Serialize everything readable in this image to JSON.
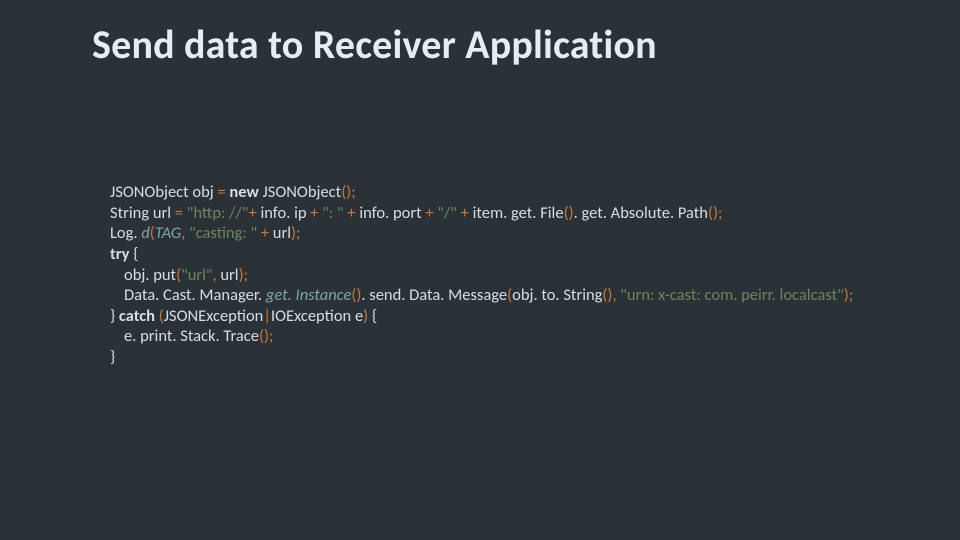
{
  "slide": {
    "title": "Send data to Receiver Application"
  },
  "code": {
    "l1": {
      "a": "JSONObject obj ",
      "eq": "= ",
      "new": "new ",
      "b": "JSONObject",
      "c": "()",
      "sc": ";"
    },
    "l2": {
      "a": "String url ",
      "eq": "= ",
      "s1": "\"http: //\"",
      "p1": "+ ",
      "b": "info. ip ",
      "p2": "+ ",
      "s2": "\": \" ",
      "p3": "+ ",
      "c": "info. port ",
      "p4": "+ ",
      "s3": "\"/\" ",
      "p5": "+ ",
      "d": "item. get. File",
      "pa1": "()",
      "dot": ". ",
      "e": "get. Absolute. Path",
      "pa2": "()",
      "sc": ";"
    },
    "l3": {
      "a": "Log. ",
      "m": "d",
      "po": "(",
      "tag": "TAG",
      "cm": ", ",
      "s": "\"casting: \" ",
      "pl": "+ ",
      "b": "url",
      "pc": ")",
      "sc": ";"
    },
    "l4": {
      "try": "try ",
      "br": "{"
    },
    "l5": {
      "a": "obj. put",
      "po": "(",
      "s": "\"url\"",
      "cm": ", ",
      "b": "url",
      "pc": ")",
      "sc": ";"
    },
    "l6": {
      "a": "Data. Cast. Manager. ",
      "gi": "get. Instance",
      "pa1": "()",
      "b": ". send. Data. Message",
      "po": "(",
      "c": "obj. to. String",
      "pa2": "()",
      "cm": ", ",
      "s": "\"urn: x-cast: com. peirr. localcast\"",
      "pc": ")",
      "sc": ";"
    },
    "l7": {
      "cb": "} ",
      "catch": "catch ",
      "po": "(",
      "a": "JSONException",
      "pipe": "|",
      "b": "IOException e",
      "pc": ") ",
      "ob": "{"
    },
    "l8": {
      "a": "e. print. Stack. Trace",
      "pa": "()",
      "sc": ";"
    },
    "l9": {
      "cb": "}"
    }
  }
}
